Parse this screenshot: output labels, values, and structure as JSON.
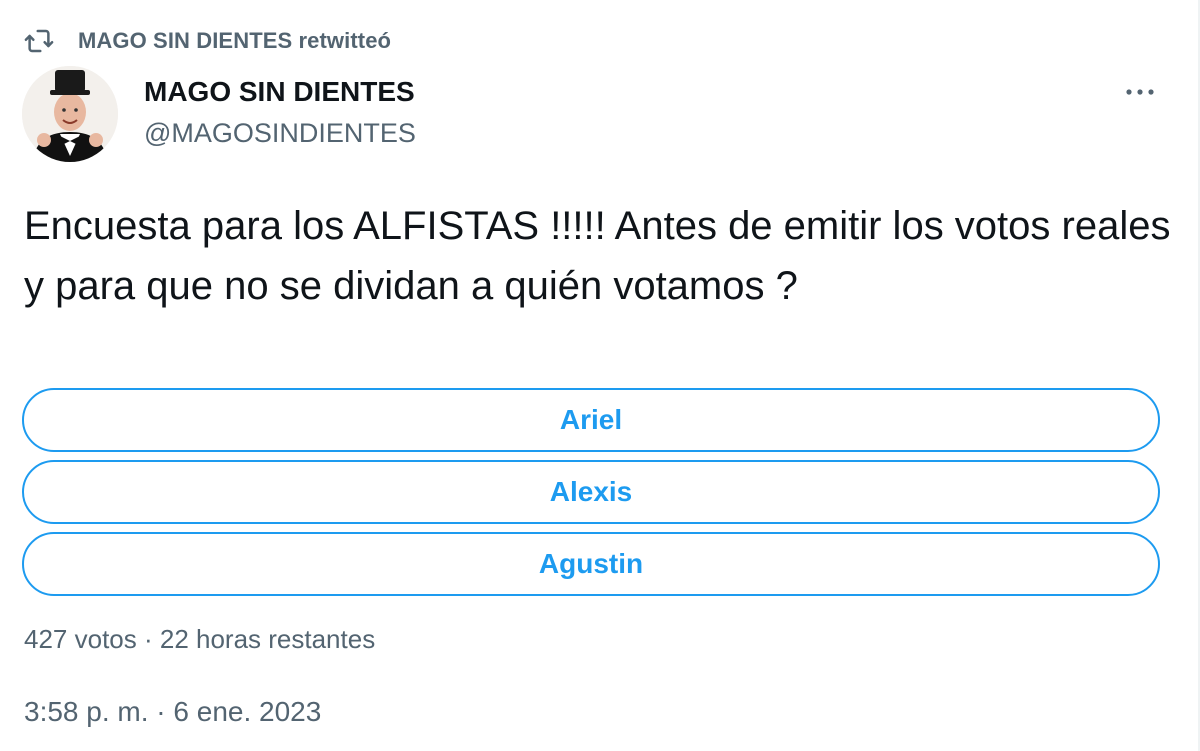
{
  "retweet": {
    "icon": "retweet-icon",
    "text": "MAGO SIN DIENTES retwitteó"
  },
  "author": {
    "avatar": "avatar",
    "display_name": "MAGO SIN DIENTES",
    "handle": "@MAGOSINDIENTES"
  },
  "more": {
    "icon": "more-icon"
  },
  "tweet": {
    "text": "Encuesta para los ALFISTAS !!!!! Antes de emitir los votos reales y para que no se dividan a quién votamos ?"
  },
  "poll": {
    "options": [
      {
        "label": "Ariel"
      },
      {
        "label": "Alexis"
      },
      {
        "label": "Agustin"
      }
    ],
    "meta": "427 votos · 22 horas restantes"
  },
  "timestamp": "3:58 p. m. · 6 ene. 2023",
  "colors": {
    "accent": "#1d9bf0",
    "secondary_text": "#536471",
    "primary_text": "#0f1419"
  }
}
